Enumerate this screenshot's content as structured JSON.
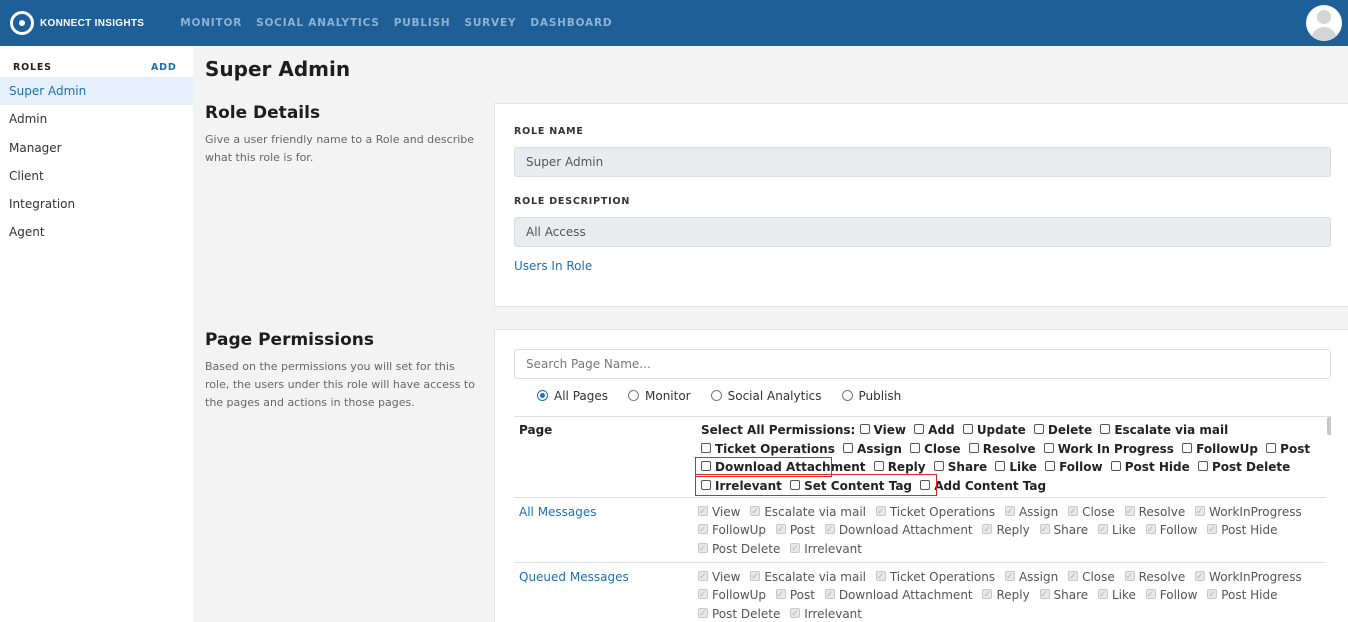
{
  "app": {
    "brand": "KONNECT INSIGHTS",
    "nav": [
      "MONITOR",
      "SOCIAL ANALYTICS",
      "PUBLISH",
      "SURVEY",
      "DASHBOARD"
    ]
  },
  "sidebar": {
    "heading": "ROLES",
    "add_label": "ADD",
    "items": [
      "Super Admin",
      "Admin",
      "Manager",
      "Client",
      "Integration",
      "Agent"
    ],
    "active": "Super Admin"
  },
  "page": {
    "title": "Super Admin"
  },
  "role_details": {
    "title": "Role Details",
    "description": "Give a user friendly name to a Role and describe what this role is for.",
    "role_name_label": "ROLE NAME",
    "role_name_value": "Super Admin",
    "role_desc_label": "ROLE DESCRIPTION",
    "role_desc_value": "All Access",
    "users_link": "Users In Role"
  },
  "page_permissions": {
    "title": "Page Permissions",
    "description": "Based on the permissions you will set for this role, the users under this role will have access to the pages and actions in those pages.",
    "search_placeholder": "Search Page Name...",
    "filters": [
      "All Pages",
      "Monitor",
      "Social Analytics",
      "Publish"
    ],
    "selected_filter": "All Pages",
    "table": {
      "page_header": "Page",
      "select_all_label": "Select All Permissions:",
      "select_all_items": [
        "View",
        "Add",
        "Update",
        "Delete",
        "Escalate via mail",
        "Ticket Operations",
        "Assign",
        "Close",
        "Resolve",
        "Work In Progress",
        "FollowUp",
        "Post",
        "Download Attachment",
        "Reply",
        "Share",
        "Like",
        "Follow",
        "Post Hide",
        "Post Delete",
        "Irrelevant",
        "Set Content Tag",
        "Add Content Tag"
      ],
      "rows": [
        {
          "page": "All Messages",
          "permissions": [
            "View",
            "Escalate via mail",
            "Ticket Operations",
            "Assign",
            "Close",
            "Resolve",
            "WorkInProgress",
            "FollowUp",
            "Post",
            "Download Attachment",
            "Reply",
            "Share",
            "Like",
            "Follow",
            "Post Hide",
            "Post Delete",
            "Irrelevant"
          ]
        },
        {
          "page": "Queued Messages",
          "permissions": [
            "View",
            "Escalate via mail",
            "Ticket Operations",
            "Assign",
            "Close",
            "Resolve",
            "WorkInProgress",
            "FollowUp",
            "Post",
            "Download Attachment",
            "Reply",
            "Share",
            "Like",
            "Follow",
            "Post Hide",
            "Post Delete",
            "Irrelevant"
          ]
        }
      ]
    }
  },
  "colors": {
    "topbar": "#1f5f97",
    "accent": "#1f6fb2",
    "highlight": "#d42a2a"
  }
}
